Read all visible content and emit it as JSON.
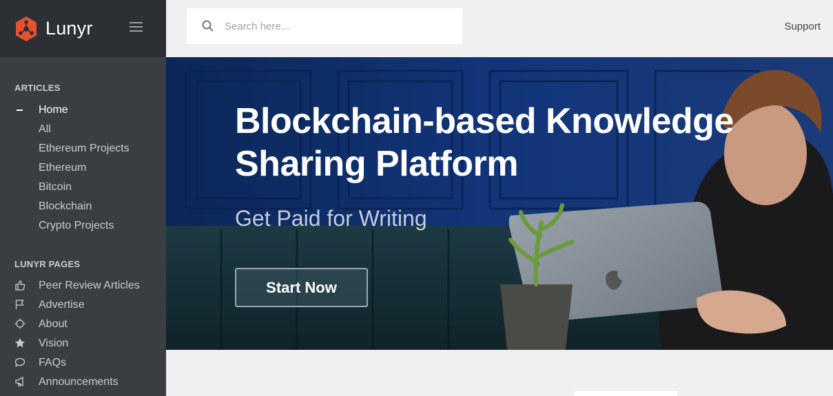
{
  "brand": {
    "name": "Lunyr",
    "accent": "#e8502f"
  },
  "search": {
    "placeholder": "Search here..."
  },
  "header": {
    "support_label": "Support"
  },
  "sidebar": {
    "articles_title": "ARTICLES",
    "articles": [
      {
        "label": "Home",
        "active": true
      },
      {
        "label": "All"
      },
      {
        "label": "Ethereum Projects"
      },
      {
        "label": "Ethereum"
      },
      {
        "label": "Bitcoin"
      },
      {
        "label": "Blockchain"
      },
      {
        "label": "Crypto Projects"
      }
    ],
    "pages_title": "LUNYR PAGES",
    "pages": [
      {
        "label": "Peer Review Articles",
        "icon": "thumbs-up-icon"
      },
      {
        "label": "Advertise",
        "icon": "flag-icon"
      },
      {
        "label": "About",
        "icon": "crosshair-icon"
      },
      {
        "label": "Vision",
        "icon": "star-icon"
      },
      {
        "label": "FAQs",
        "icon": "chat-bubble-icon"
      },
      {
        "label": "Announcements",
        "icon": "megaphone-icon"
      }
    ]
  },
  "hero": {
    "title": "Blockchain-based Knowledge Sharing Platform",
    "subtitle": "Get Paid for Writing",
    "cta_label": "Start Now"
  }
}
